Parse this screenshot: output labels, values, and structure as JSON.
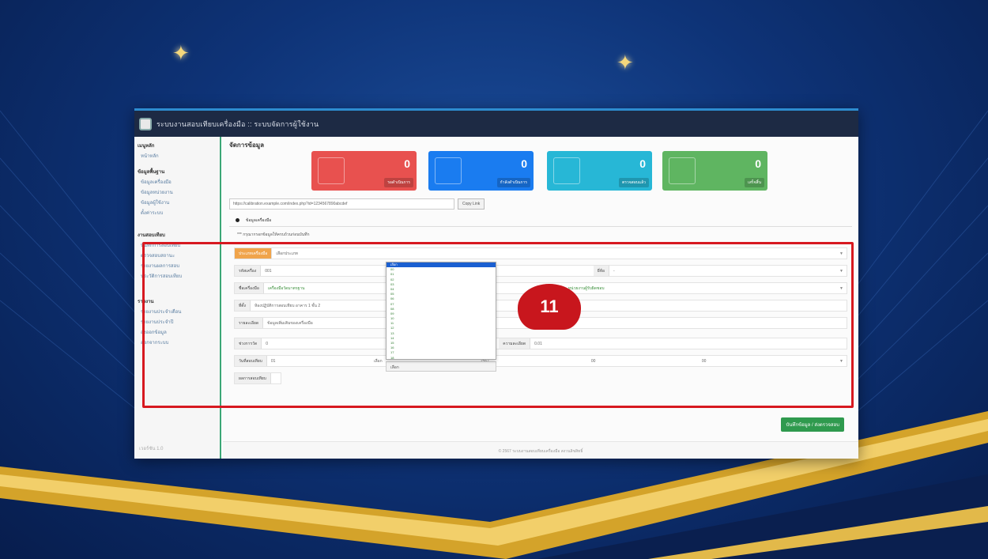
{
  "app": {
    "title": "ระบบงานสอบเทียบเครื่องมือ :: ระบบจัดการผู้ใช้งาน"
  },
  "sidebar": {
    "groups": [
      {
        "head": "เมนูหลัก",
        "items": [
          "หน้าหลัก"
        ]
      },
      {
        "head": "ข้อมูลพื้นฐาน",
        "items": [
          "ข้อมูลเครื่องมือ",
          "ข้อมูลหน่วยงาน",
          "ข้อมูลผู้ใช้งาน",
          "ตั้งค่าระบบ"
        ]
      },
      {
        "head": "งานสอบเทียบ",
        "items": [
          "บันทึกการสอบเทียบ",
          "ตรวจสอบสถานะ",
          "รายงานผลการสอบ",
          "ประวัติการสอบเทียบ"
        ]
      },
      {
        "head": "รายงาน",
        "items": [
          "รายงานประจำเดือน",
          "รายงานประจำปี",
          "ส่งออกข้อมูล",
          "ออกจากระบบ"
        ]
      }
    ],
    "footer": "เวอร์ชัน 1.0"
  },
  "main": {
    "page_title": "จัดการข้อมูล",
    "cards": [
      {
        "value": "0",
        "tag": "รอดำเนินการ",
        "color": "#e8514f"
      },
      {
        "value": "0",
        "tag": "กำลังดำเนินการ",
        "color": "#1a7cf0"
      },
      {
        "value": "0",
        "tag": "ตรวจสอบแล้ว",
        "color": "#27b7d6"
      },
      {
        "value": "0",
        "tag": "เสร็จสิ้น",
        "color": "#5fb561"
      }
    ],
    "url": "https://calibration.example.com/index.php?id=1234567890abcdef",
    "copy_label": "Copy Link",
    "tab_label": "ข้อมูลเครื่องมือ",
    "note": "*** กรุณากรอกข้อมูลให้ครบถ้วนก่อนบันทึก",
    "form": {
      "row1": {
        "label": "ประเภทเครื่องมือ",
        "value": "เลือกประเภท"
      },
      "row2": {
        "label": "รหัสเครื่อง",
        "value": "001",
        "label2": "ยี่ห้อ",
        "value2": "-"
      },
      "row3": {
        "label": "ชื่อเครื่องมือ",
        "value": "เครื่องมือวัดมาตรฐาน",
        "value2": "หน่วยงานผู้รับผิดชอบ"
      },
      "row4": {
        "label": "ที่ตั้ง",
        "value": "ห้องปฏิบัติการสอบเทียบ อาคาร 1 ชั้น 2"
      },
      "row5": {
        "label": "รายละเอียด",
        "value": "ข้อมูลเพิ่มเติมของเครื่องมือ"
      },
      "row6": {
        "label": "ช่วงการวัด",
        "value": "0",
        "label2": "ความละเอียด",
        "value2": "0.01"
      },
      "row7": {
        "label": "วันที่สอบเทียบ",
        "value": "01",
        "value2": "เลือก",
        "value3": "2567",
        "value4": "00",
        "value5": "00"
      },
      "row8": {
        "label": "ผลการสอบเทียบ"
      }
    },
    "dropdown_options": [
      "เลือก",
      "00",
      "01",
      "02",
      "03",
      "04",
      "05",
      "06",
      "07",
      "08",
      "09",
      "10",
      "11",
      "12",
      "13",
      "14",
      "15",
      "16",
      "17",
      "18"
    ],
    "save_label": "บันทึกข้อมูล / ส่งตรวจสอบ",
    "footer": "© 2567 ระบบงานสอบเทียบเครื่องมือ สงวนลิขสิทธิ์"
  },
  "overlay": {
    "step_number": "11",
    "highlight_color": "#d71920"
  }
}
